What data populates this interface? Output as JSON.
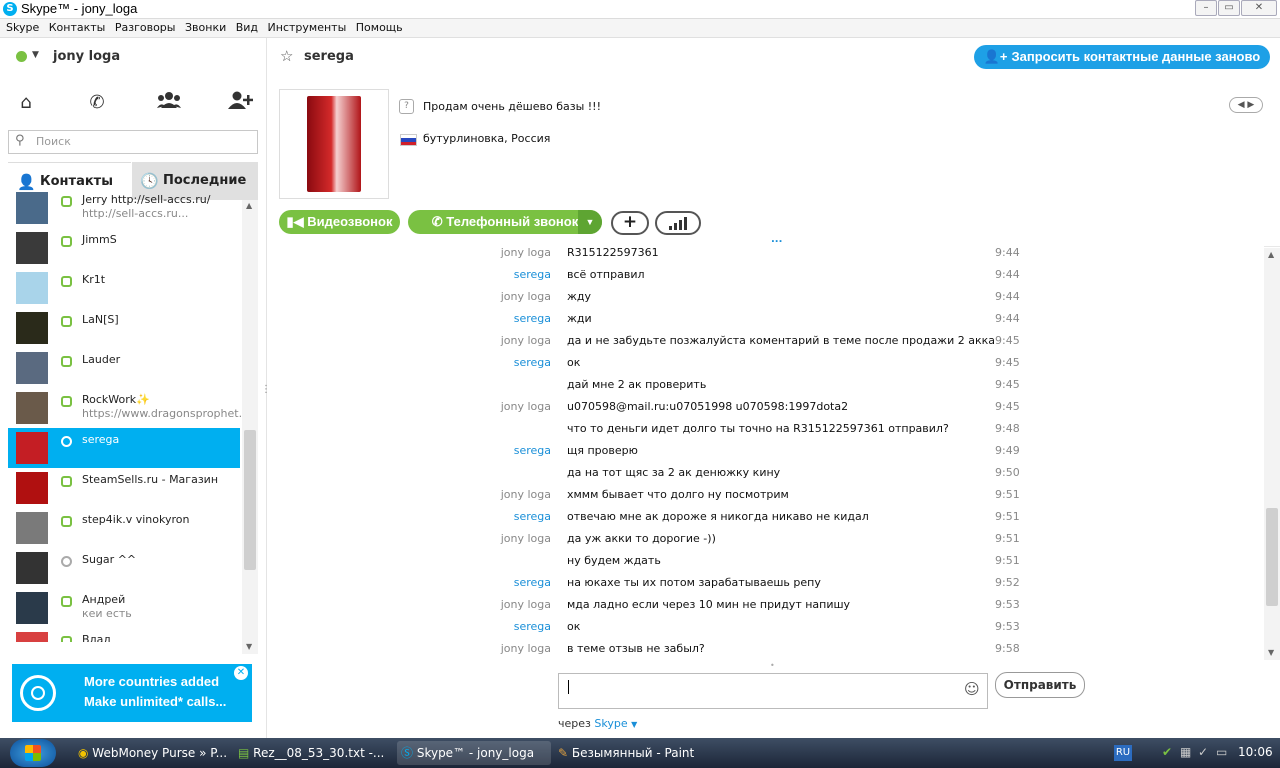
{
  "window": {
    "title": "Skype™ - jony_loga",
    "logo": "S"
  },
  "menu": [
    "Skype",
    "Контакты",
    "Разговоры",
    "Звонки",
    "Вид",
    "Инструменты",
    "Помощь"
  ],
  "profile": {
    "name": "jony loga"
  },
  "search": {
    "placeholder": "Поиск"
  },
  "tabs": {
    "contacts": "Контакты",
    "recent": "Последние"
  },
  "contacts": [
    {
      "name": "Jerry http://sell-accs.ru/",
      "sub": "http://sell-accs.ru...",
      "status": "online",
      "avatar_color": "#4a6a8a"
    },
    {
      "name": "JimmS",
      "sub": "",
      "status": "online",
      "avatar_color": "#3a3a3a"
    },
    {
      "name": "Kr1t",
      "sub": "",
      "status": "online",
      "avatar_color": "#a9d4ea"
    },
    {
      "name": "LaN[S]",
      "sub": "",
      "status": "online",
      "avatar_color": "#2a2a1a"
    },
    {
      "name": "Lauder",
      "sub": "",
      "status": "online",
      "avatar_color": "#5a6a80"
    },
    {
      "name": "RockWork✨",
      "sub": "https://www.dragonsprophet...",
      "status": "online",
      "avatar_color": "#6a5a4a"
    },
    {
      "name": "serega",
      "sub": "",
      "status": "unknown",
      "avatar_color": "#c41e24",
      "selected": true
    },
    {
      "name": "SteamSells.ru - Магазин",
      "sub": "",
      "status": "online",
      "avatar_color": "#b01010"
    },
    {
      "name": "step4ik.v vinokyron",
      "sub": "",
      "status": "online",
      "avatar_color": "#7a7a7a"
    },
    {
      "name": "Sugar ^^",
      "sub": "",
      "status": "unknown",
      "avatar_color": "#333333"
    },
    {
      "name": "Андрей",
      "sub": "кеи есть",
      "status": "online",
      "avatar_color": "#2a3a4a"
    },
    {
      "name": "Влад",
      "sub": "",
      "status": "online",
      "avatar_color": "#d84040"
    }
  ],
  "ad": {
    "line1": "More countries added",
    "line2": "Make unlimited* calls..."
  },
  "chat": {
    "contact_name": "serega",
    "request_button": "Запросить контактные данные заново",
    "mood": "Продам очень дёшево базы !!!",
    "location": "бутурлиновка, Россия",
    "video_call": "Видеозвонок",
    "phone_call": "Телефонный звонок",
    "add": "+",
    "more_dots": "..."
  },
  "messages": [
    {
      "sender": "jony loga",
      "text": "R315122597361",
      "time": "9:44"
    },
    {
      "sender": "serega",
      "text": "всё отправил",
      "time": "9:44"
    },
    {
      "sender": "jony loga",
      "text": "жду",
      "time": "9:44"
    },
    {
      "sender": "serega",
      "text": "жди",
      "time": "9:44"
    },
    {
      "sender": "jony loga",
      "text": "да и не забудьте позжалуйста коментарий в теме после продажи 2 акка",
      "time": "9:45"
    },
    {
      "sender": "serega",
      "text": "ок",
      "time": "9:45"
    },
    {
      "sender": "",
      "text": "дай мне 2 ак проверить",
      "time": "9:45"
    },
    {
      "sender": "jony loga",
      "text": "u070598@mail.ru:u07051998 u070598:1997dota2",
      "time": "9:45"
    },
    {
      "sender": "",
      "text": "что то деньги идет долго ты точно на R315122597361 отправил?",
      "time": "9:48"
    },
    {
      "sender": "serega",
      "text": "щя проверю",
      "time": "9:49"
    },
    {
      "sender": "",
      "text": "да на тот щяс за 2 ак денюжку кину",
      "time": "9:50"
    },
    {
      "sender": "jony loga",
      "text": "хммм бывает что долго ну посмотрим",
      "time": "9:51"
    },
    {
      "sender": "serega",
      "text": "отвечаю мне ак дороже я никогда никаво не кидал",
      "time": "9:51"
    },
    {
      "sender": "jony loga",
      "text": "да уж акки то дорогие -))",
      "time": "9:51"
    },
    {
      "sender": "",
      "text": "ну будем ждать",
      "time": "9:51"
    },
    {
      "sender": "serega",
      "text": "на юкахе ты их потом зарабатываешь репу",
      "time": "9:52"
    },
    {
      "sender": "jony loga",
      "text": "мда ладно если через 10 мин не придут напишу",
      "time": "9:53"
    },
    {
      "sender": "serega",
      "text": "ок",
      "time": "9:53"
    },
    {
      "sender": "jony loga",
      "text": "в теме отзыв не забыл?",
      "time": "9:58"
    }
  ],
  "composer": {
    "send": "Отправить",
    "via_prefix": "через",
    "via": "Skype"
  },
  "taskbar": {
    "tasks": [
      "WebMoney Purse » P...",
      "Rez__08_53_30.txt -...",
      "Skype™ - jony_loga",
      "Безымянный - Paint"
    ],
    "lang": "RU",
    "clock": "10:06"
  }
}
